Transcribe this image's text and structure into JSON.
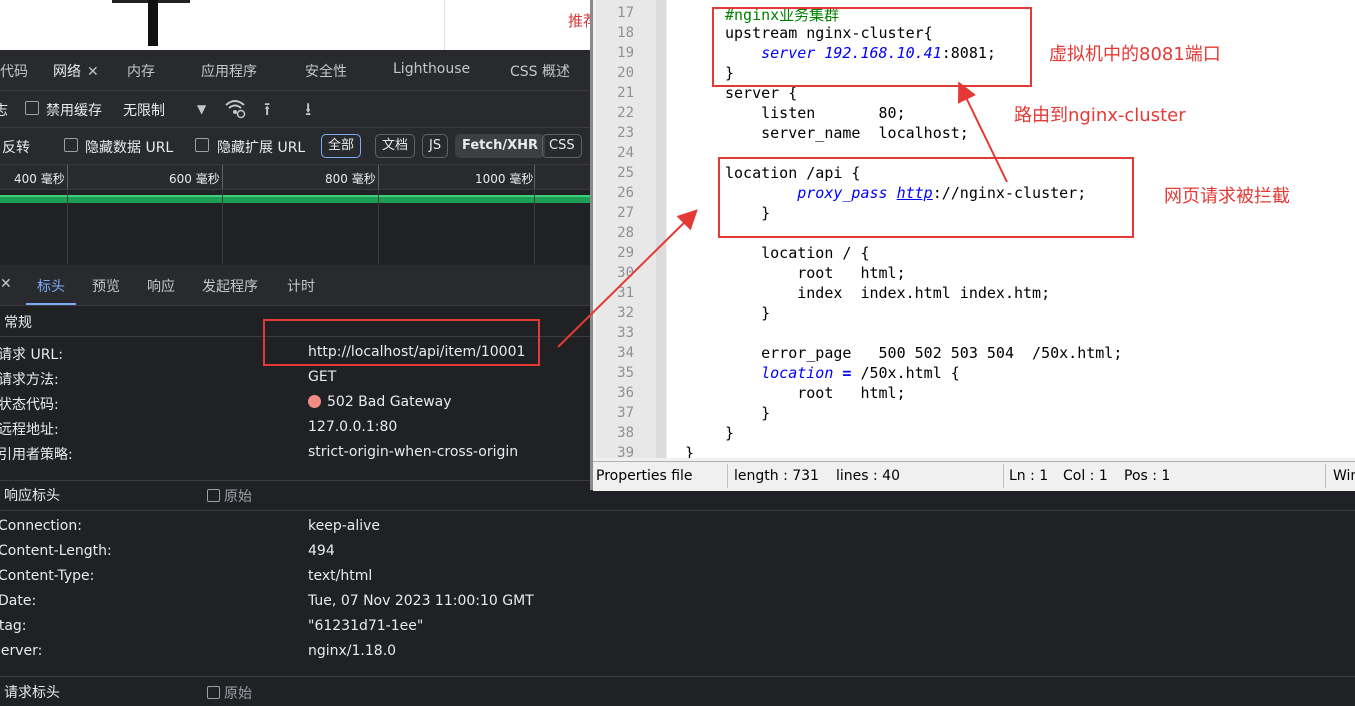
{
  "top_page": {
    "recommend_text": "推荐"
  },
  "devtools": {
    "tabs": [
      "代码",
      "网络",
      "内存",
      "应用程序",
      "安全性",
      "Lighthouse",
      "CSS 概述"
    ],
    "toolbar1": {
      "preserve_label": "志",
      "disable_cache": "禁用缓存",
      "throttle": "无限制"
    },
    "toolbar2": {
      "invert": "反转",
      "hide_data_url": "隐藏数据 URL",
      "hide_ext_url": "隐藏扩展 URL",
      "filters": [
        "全部",
        "文档",
        "JS",
        "Fetch/XHR",
        "CSS"
      ]
    },
    "ruler_ticks": [
      "400 毫秒",
      "600 毫秒",
      "800 毫秒",
      "1000 毫秒"
    ],
    "detail_tabs": [
      "标头",
      "预览",
      "响应",
      "发起程序",
      "计时"
    ],
    "general": {
      "title": "常规",
      "rows": [
        {
          "key": "请求 URL:",
          "value": "http://localhost/api/item/10001"
        },
        {
          "key": "请求方法:",
          "value": "GET"
        },
        {
          "key": "状态代码:",
          "value": "502 Bad Gateway"
        },
        {
          "key": "远程地址:",
          "value": "127.0.0.1:80"
        },
        {
          "key": "引用者策略:",
          "value": "strict-origin-when-cross-origin"
        }
      ]
    },
    "response_headers": {
      "title": "响应标头",
      "raw": "原始",
      "rows": [
        {
          "key": "Connection:",
          "value": "keep-alive"
        },
        {
          "key": "Content-Length:",
          "value": "494"
        },
        {
          "key": "Content-Type:",
          "value": "text/html"
        },
        {
          "key": "Date:",
          "value": "Tue, 07 Nov 2023 11:00:10 GMT"
        },
        {
          "key": "Etag:",
          "value": "\"61231d71-1ee\""
        },
        {
          "key": "Server:",
          "value": "nginx/1.18.0"
        }
      ]
    },
    "request_headers": {
      "title": "请求标头",
      "raw": "原始"
    }
  },
  "editor": {
    "line_numbers": [
      "17",
      "18",
      "19",
      "20",
      "21",
      "22",
      "23",
      "24",
      "25",
      "26",
      "27",
      "28",
      "29",
      "30",
      "31",
      "32",
      "33",
      "34",
      "35",
      "36",
      "37",
      "38",
      "39"
    ],
    "status": {
      "file_type": "Properties file",
      "length": "length : 731",
      "lines": "lines : 40",
      "ln": "Ln : 1",
      "col": "Col : 1",
      "pos": "Pos : 1",
      "eol": "Win"
    }
  },
  "annotations": {
    "vm_port": "虚拟机中的8081端口",
    "route_to": "路由到nginx-cluster",
    "intercepted": "网页请求被拦截"
  }
}
